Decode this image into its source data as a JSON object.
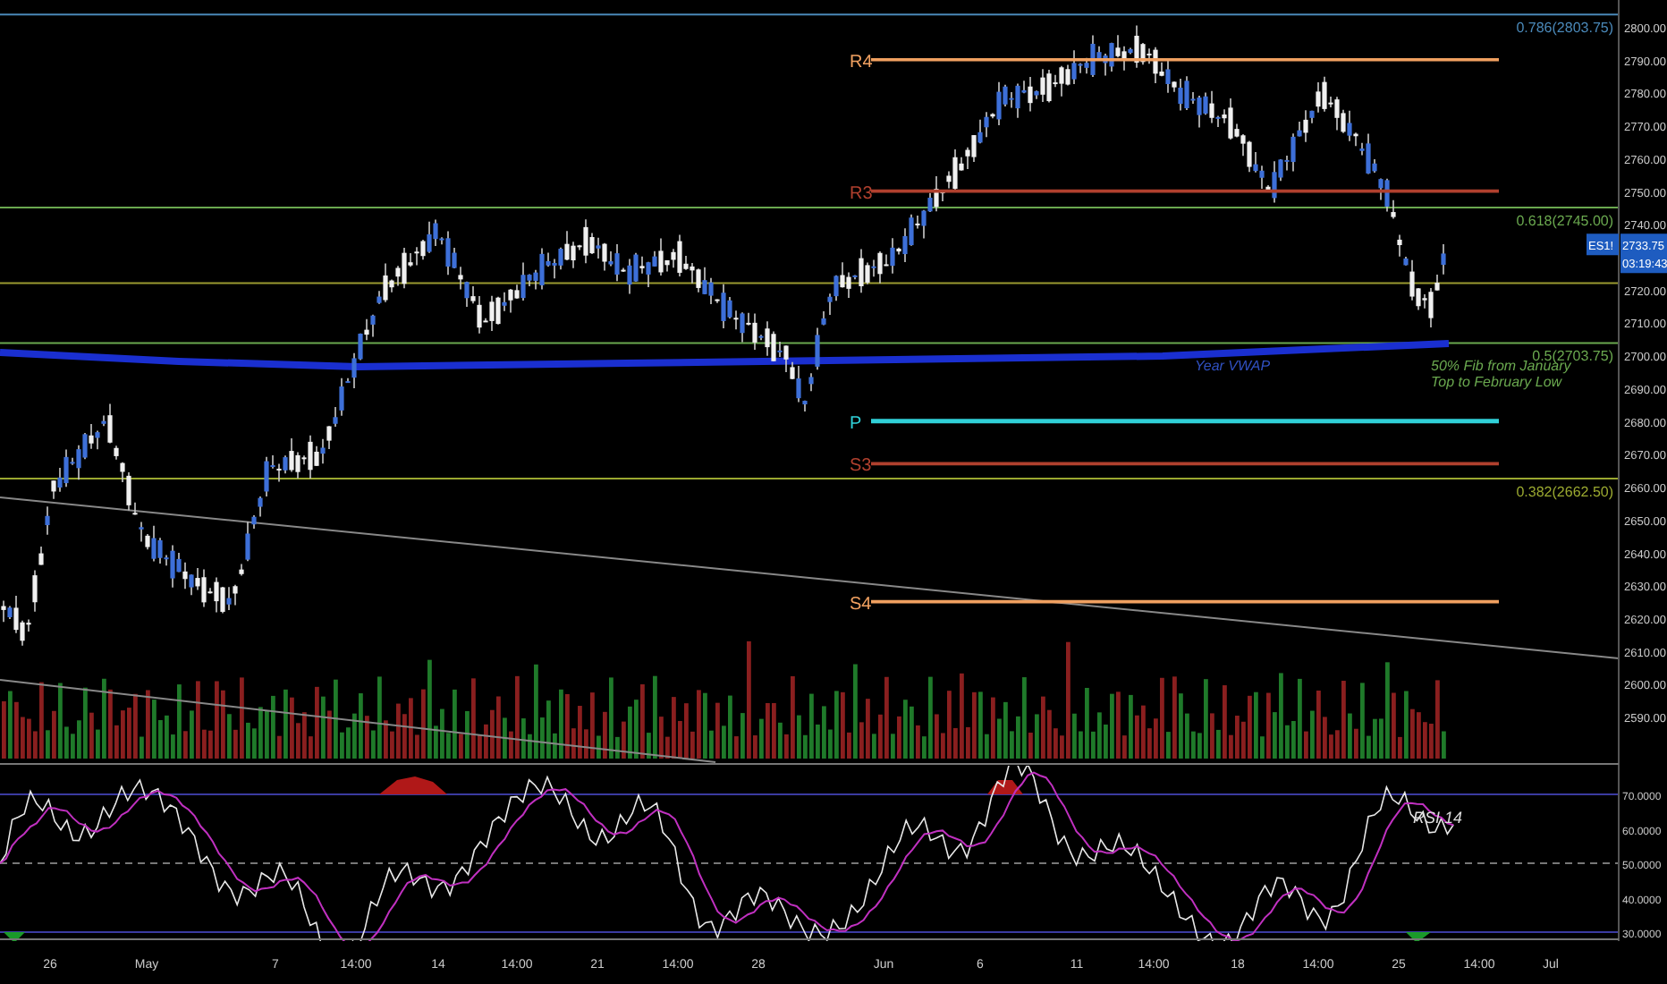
{
  "price_axis": {
    "ticks": [
      "2800.00",
      "2790.00",
      "2780.00",
      "2770.00",
      "2760.00",
      "2750.00",
      "2740.00",
      "2720.00",
      "2710.00",
      "2700.00",
      "2690.00",
      "2680.00",
      "2670.00",
      "2660.00",
      "2650.00",
      "2640.00",
      "2630.00",
      "2620.00",
      "2610.00",
      "2600.00",
      "2590.00"
    ]
  },
  "last_price": {
    "symbol": "ES1!",
    "price": "2733.75",
    "countdown": "03:19:43"
  },
  "pivot_levels": [
    {
      "label": "R4",
      "color": "#f0a060"
    },
    {
      "label": "R3",
      "color": "#b0402e"
    },
    {
      "label": "P",
      "color": "#30d0d8"
    },
    {
      "label": "S3",
      "color": "#b0402e"
    },
    {
      "label": "S4",
      "color": "#f0a060"
    }
  ],
  "fib_levels": [
    {
      "label": "0.786(2803.75)",
      "color": "#4a88b8"
    },
    {
      "label": "0.618(2745.00)",
      "color": "#6aa84f"
    },
    {
      "label": "0.5(2703.75)",
      "color": "#6aa84f"
    },
    {
      "label": "0.382(2662.50)",
      "color": "#9aa830"
    }
  ],
  "annotations": [
    {
      "text": "Year VWAP",
      "color": "#3050c0"
    },
    {
      "text": "50% Fib from January",
      "color": "#6aa84f"
    },
    {
      "text": "Top to February Low",
      "color": "#6aa84f"
    }
  ],
  "rsi": {
    "label": "RSI 14",
    "ticks": [
      "70.0000",
      "60.0000",
      "50.0000",
      "40.0000",
      "30.0000"
    ]
  },
  "time_axis": {
    "ticks": [
      "26",
      "May",
      "7",
      "14:00",
      "14",
      "14:00",
      "21",
      "14:00",
      "28",
      "Jun",
      "6",
      "11",
      "14:00",
      "18",
      "14:00",
      "25",
      "14:00",
      "Jul"
    ]
  }
}
